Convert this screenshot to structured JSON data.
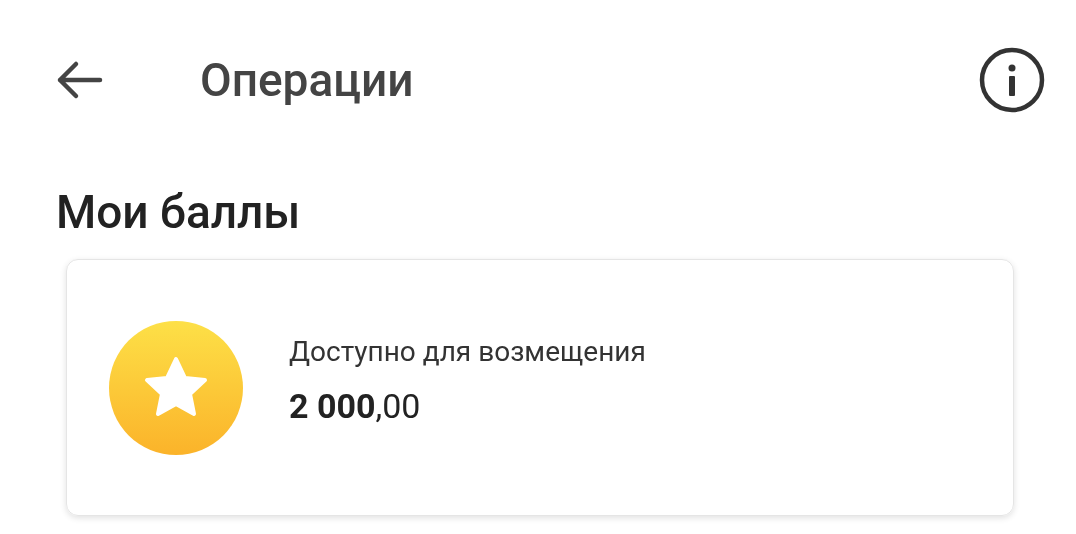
{
  "header": {
    "title": "Операции"
  },
  "section_title": "Мои баллы",
  "card": {
    "label": "Доступно для возмещения",
    "amount": "**2 000**,00"
  }
}
